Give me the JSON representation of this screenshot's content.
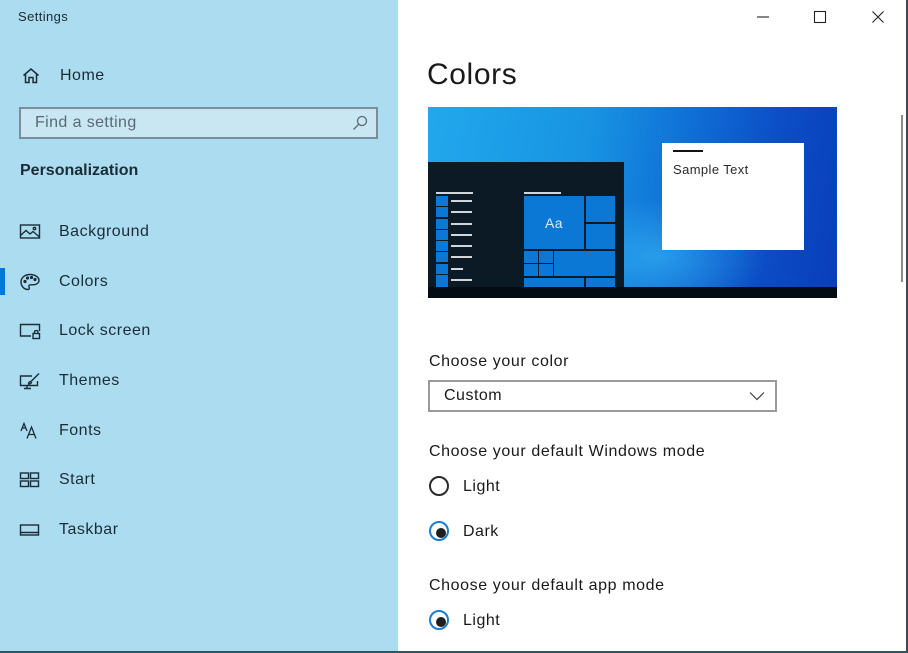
{
  "window": {
    "title": "Settings",
    "controls": [
      "minimize",
      "maximize",
      "close"
    ]
  },
  "sidebar": {
    "home_label": "Home",
    "search": {
      "placeholder": "Find a setting",
      "value": ""
    },
    "section_title": "Personalization",
    "items": [
      {
        "label": "Background",
        "icon": "image-icon",
        "active": false
      },
      {
        "label": "Colors",
        "icon": "palette-icon",
        "active": true
      },
      {
        "label": "Lock screen",
        "icon": "lock-screen-icon",
        "active": false
      },
      {
        "label": "Themes",
        "icon": "themes-brush-icon",
        "active": false
      },
      {
        "label": "Fonts",
        "icon": "fonts-icon",
        "active": false
      },
      {
        "label": "Start",
        "icon": "start-tiles-icon",
        "active": false
      },
      {
        "label": "Taskbar",
        "icon": "taskbar-icon",
        "active": false
      }
    ]
  },
  "main": {
    "title": "Colors",
    "preview": {
      "tile_text": "Aa",
      "sample_text": "Sample Text"
    },
    "color_choice": {
      "label": "Choose your color",
      "selected": "Custom"
    },
    "windows_mode": {
      "label": "Choose your default Windows mode",
      "options": [
        {
          "label": "Light",
          "checked": false
        },
        {
          "label": "Dark",
          "checked": true
        }
      ]
    },
    "app_mode": {
      "label": "Choose your default app mode",
      "options": [
        {
          "label": "Light",
          "checked": true
        }
      ]
    }
  },
  "colors": {
    "accent": "#0078d7",
    "sidebar_background": "#acdcef",
    "preview_tile": "#0a78d4"
  }
}
